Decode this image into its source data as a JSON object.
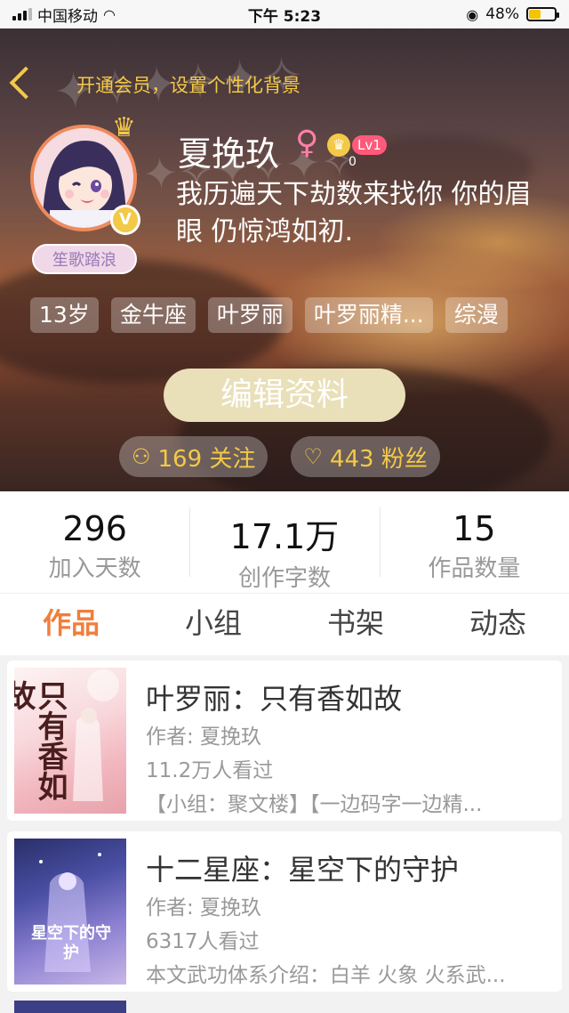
{
  "status_bar": {
    "carrier": "中国移动",
    "time": "下午 5:23",
    "battery_text": "48%",
    "battery_level": 0.48
  },
  "header": {
    "back_icon": "chevron-left-icon",
    "vip_link": "开通会员，设置个性化背景",
    "nickname": "夏挽玖",
    "gender_symbol": "♀",
    "level_label": "Lv1",
    "level_value": "0",
    "bio": "我历遍天下劫数来找你 你的眉眼 仍惊鸿如初.",
    "user_badge": "笙歌踏浪",
    "tags": [
      "13岁",
      "金牛座",
      "叶罗丽",
      "叶罗丽精...",
      "综漫"
    ],
    "edit_button": "编辑资料",
    "following": "169 关注",
    "followers": "443 粉丝"
  },
  "stats": [
    {
      "value": "296",
      "label": "加入天数"
    },
    {
      "value": "17.1万",
      "label": "创作字数"
    },
    {
      "value": "15",
      "label": "作品数量"
    }
  ],
  "tabs": [
    "作品",
    "小组",
    "书架",
    "动态"
  ],
  "works": [
    {
      "title": "叶罗丽：只有香如故",
      "author": "作者: 夏挽玖",
      "views": "11.2万人看过",
      "extra": "【小组：聚文楼】【一边码字一边精...",
      "cover_text": "只有香如故"
    },
    {
      "title": "十二星座：星空下的守护",
      "author": "作者: 夏挽玖",
      "views": "6317人看过",
      "extra": "本文武功体系介绍：白羊 火象 火系武...",
      "cover_text": "星空下的守护"
    }
  ],
  "colors": {
    "accent": "#f07e3c",
    "gold": "#f3c948"
  }
}
